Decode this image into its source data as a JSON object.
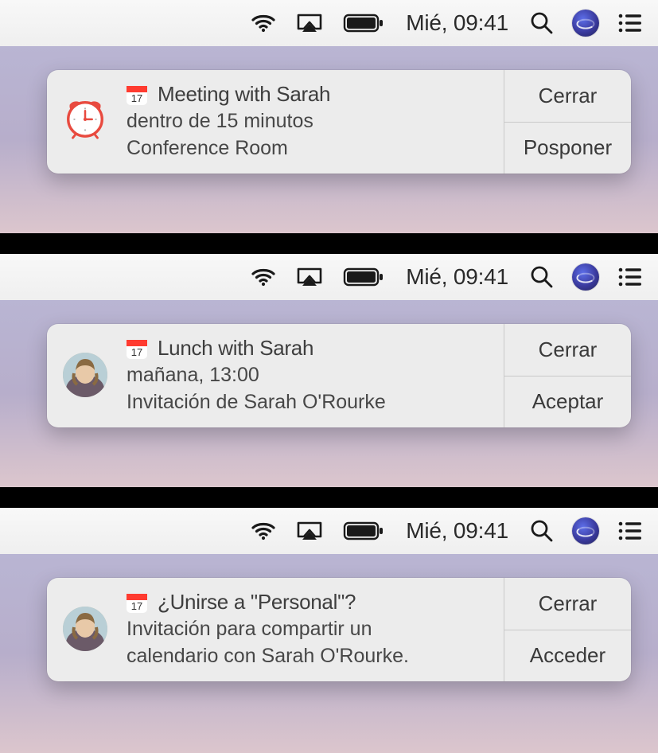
{
  "menubar": {
    "datetime": "Mié, 09:41"
  },
  "notifications": [
    {
      "icon_type": "alarm",
      "title": "Meeting with Sarah",
      "line1": "dentro de 15 minutos",
      "line2": "Conference Room",
      "action1": "Cerrar",
      "action2": "Posponer"
    },
    {
      "icon_type": "avatar",
      "title": "Lunch with Sarah",
      "line1": "mañana, 13:00",
      "line2": "Invitación de Sarah O'Rourke",
      "action1": "Cerrar",
      "action2": "Aceptar"
    },
    {
      "icon_type": "avatar",
      "title": "¿Unirse a \"Personal\"?",
      "line1": "Invitación para compartir un",
      "line2": "calendario con Sarah O'Rourke.",
      "action1": "Cerrar",
      "action2": "Acceder"
    }
  ]
}
